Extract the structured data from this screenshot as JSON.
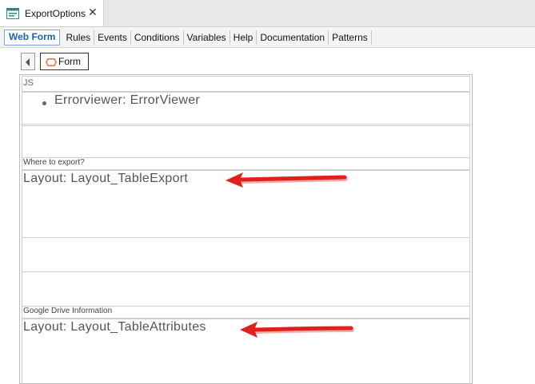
{
  "window": {
    "tab_title": "ExportOptions",
    "close_glyph": "✕"
  },
  "section_tabs": [
    "Web Form",
    "Rules",
    "Events",
    "Conditions",
    "Variables",
    "Help",
    "Documentation",
    "Patterns"
  ],
  "active_section_tab": "Web Form",
  "toolbar": {
    "form_label": "Form"
  },
  "form": {
    "js_label": "JS",
    "errorviewer_item": "Errorviewer: ErrorViewer",
    "where_label": "Where to export?",
    "layout1": "Layout: Layout_TableExport",
    "google_label": "Google Drive Information",
    "layout2": "Layout: Layout_TableAttributes"
  },
  "colors": {
    "active_tab_text": "#1b63b8",
    "arrow_red": "#e0201b",
    "form_icon": "#e0602a"
  }
}
